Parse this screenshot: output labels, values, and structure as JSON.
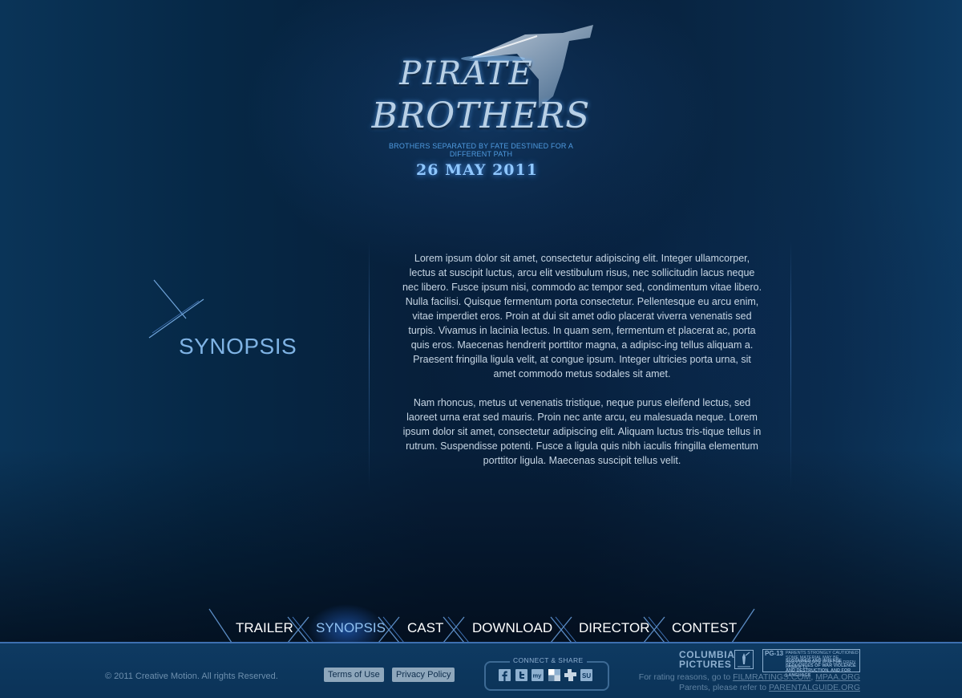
{
  "logo": {
    "title_line1": "PIRATE",
    "title_line2": "BROTHERS",
    "tagline": "BROTHERS SEPARATED BY FATE DESTINED FOR A DIFFERENT PATH",
    "release_date": "26 MAY 2011"
  },
  "section": {
    "heading": "SYNOPSIS",
    "paragraphs": [
      "Lorem ipsum dolor sit amet, consectetur adipiscing elit. Integer ullamcorper, lectus at suscipit luctus, arcu elit vestibulum risus, nec sollicitudin lacus neque nec libero. Fusce ipsum nisi, commodo ac tempor sed, condimentum vitae libero. Nulla facilisi. Quisque fermentum porta consectetur. Pellentesque eu arcu enim, vitae imperdiet eros. Proin at dui sit amet odio placerat viverra venenatis sed turpis. Vivamus in lacinia lectus. In quam sem, fermentum et placerat ac, porta quis eros. Maecenas hendrerit porttitor magna, a adipisc-ing tellus aliquam a. Praesent fringilla ligula velit, at congue ipsum. Integer ultricies porta urna, sit amet commodo metus sodales sit amet.",
      "Nam rhoncus, metus ut venenatis tristique, neque purus eleifend lectus, sed laoreet urna erat sed mauris. Proin nec ante arcu, eu malesuada neque. Lorem ipsum dolor sit amet, consectetur adipiscing elit. Aliquam luctus tris-tique tellus in rutrum. Suspendisse potenti. Fusce a ligula quis nibh iaculis fringilla elementum porttitor ligula. Maecenas suscipit tellus velit."
    ]
  },
  "nav": {
    "items": [
      {
        "label": "TRAILER"
      },
      {
        "label": "SYNOPSIS",
        "active": true
      },
      {
        "label": "CAST"
      },
      {
        "label": "DOWNLOAD"
      },
      {
        "label": "DIRECTOR"
      },
      {
        "label": "CONTEST"
      }
    ]
  },
  "footer": {
    "copyright": "© 2011 Creative Motion. All rights Reserved.",
    "terms": "Terms of Use",
    "privacy": "Privacy Policy",
    "connect_label": "CONNECT & SHARE",
    "social_icons": [
      "facebook-icon",
      "twitter-icon",
      "myspace-icon",
      "delicious-icon",
      "digg-icon",
      "stumbleupon-icon"
    ],
    "studio_line1": "COLUMBIA",
    "studio_line2": "PICTURES",
    "rating": {
      "code": "PG-13",
      "caution": "PARENTS STRONGLY CAUTIONED",
      "caution_note": "SOME MATERIAL MAY BE INAPPROPRIATE FOR CHILDREN UNDER 13",
      "reason": "SUSTAINED AND INTENSE SEQUENCES OF WAR VIOLENCE AND DESTRUCTION, AND FOR LANGUAGE"
    },
    "rating_reasons_prefix": "For rating reasons, go to",
    "filmratings_link": "FILMRATINGS.COM",
    "mpaa_link": "MPAA.ORG",
    "parents_prefix": "Parents, please refer to",
    "parentalguide_link": "PARENTALGUIDE.ORG"
  },
  "colors": {
    "background": "#071f3a",
    "accent": "#3d6fb0",
    "nav_active": "#8fc0f0",
    "heading": "#7fb3e4"
  }
}
